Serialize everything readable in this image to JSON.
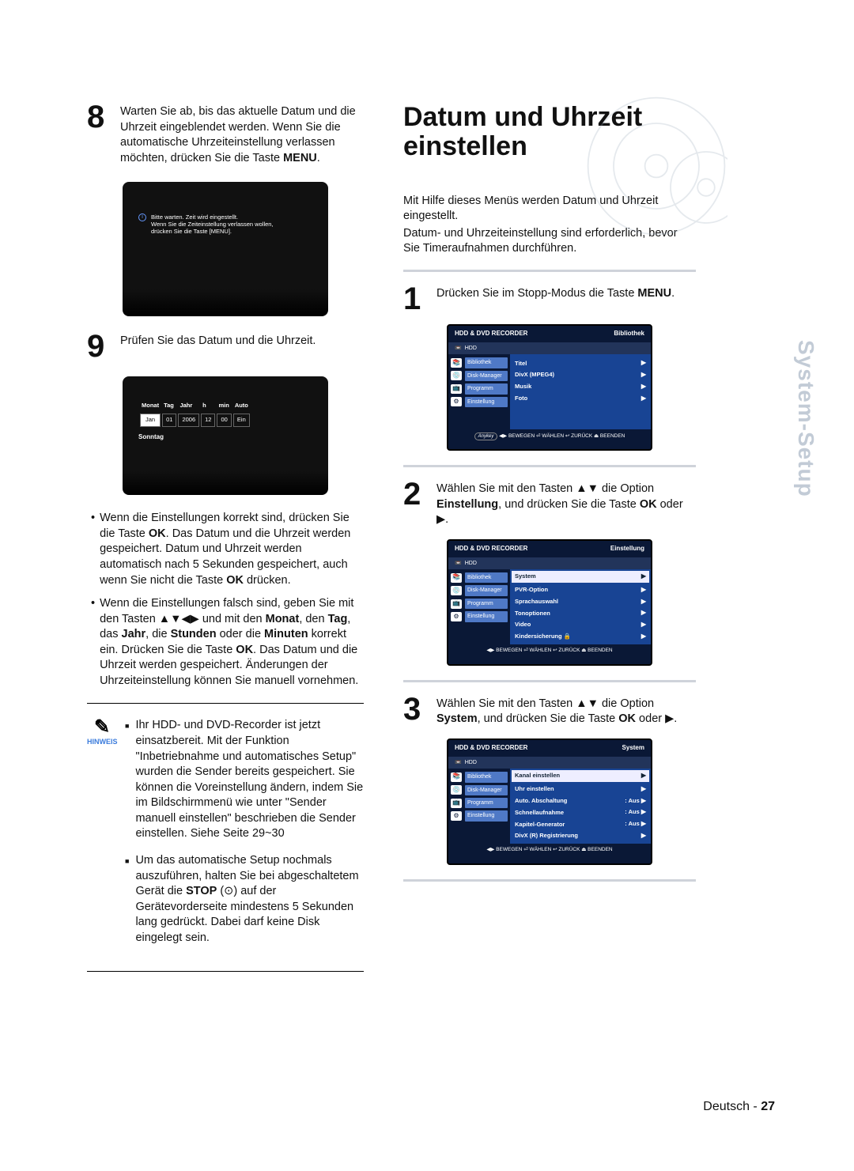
{
  "left": {
    "step8": {
      "num": "8",
      "text_a": "Warten Sie ab, bis das aktuelle Datum und die Uhrzeit eingeblendet werden. Wenn Sie die automatische Uhrzeiteinstellung verlassen möchten, drücken Sie die Taste ",
      "text_b": "MENU",
      "text_c": "."
    },
    "osd1": {
      "l1": "Bitte warten. Zeit wird eingestellt.",
      "l2": "Wenn Sie die Zeiteinstellung verlassen wollen,",
      "l3": "drücken Sie die Taste [MENU]."
    },
    "step9": {
      "num": "9",
      "text": "Prüfen Sie das Datum und die Uhrzeit."
    },
    "date": {
      "hdr": [
        "Monat",
        "Tag",
        "Jahr",
        "h",
        "min",
        "Auto"
      ],
      "row": [
        "Jan",
        "01",
        "2006",
        "12",
        "00",
        "Ein"
      ],
      "day": "Sonntag"
    },
    "bul1": {
      "a1": "Wenn die Einstellungen korrekt sind, drücken Sie die Taste ",
      "a2": "OK",
      "a3": ". Das Datum und die Uhrzeit werden gespeichert. Datum und Uhrzeit werden automatisch nach 5 Sekunden gespeichert, auch wenn Sie nicht die Taste ",
      "a4": "OK",
      "a5": " drücken."
    },
    "bul2": {
      "a1": "Wenn die Einstellungen falsch sind, geben Sie mit den Tasten ▲▼◀▶ und mit den ",
      "a2": "Monat",
      "a3": ", den ",
      "a4": "Tag",
      "a5": ", das ",
      "a6": "Jahr",
      "a7": ", die ",
      "a8": "Stunden",
      "a9": " oder die ",
      "a10": "Minuten",
      "a11": " korrekt ein. Drücken Sie die Taste ",
      "a12": "OK",
      "a13": ". Das Datum und die Uhrzeit werden gespeichert. Änderungen der Uhrzeiteinstellung können Sie manuell vornehmen."
    },
    "hinweis_label": "HINWEIS",
    "note1": "Ihr HDD- und DVD-Recorder ist jetzt einsatzbereit. Mit der Funktion \"Inbetriebnahme und automatisches Setup\" wurden die Sender bereits gespeichert. Sie können die Voreinstellung ändern, indem Sie im Bildschirmmenü wie unter \"Sender manuell einstellen\" beschrieben die Sender einstellen. Siehe Seite 29~30",
    "note2_a": "Um das automatische Setup nochmals auszuführen, halten Sie bei abgeschaltetem Gerät die ",
    "note2_b": "STOP",
    "note2_c": " (⊙) auf der Gerätevorderseite mindestens 5 Sekunden lang gedrückt. Dabei darf keine Disk eingelegt sein."
  },
  "right": {
    "title": "Datum und Uhrzeit einstellen",
    "intro1": "Mit Hilfe dieses Menüs werden Datum und Uhrzeit eingestellt.",
    "intro2": "Datum- und Uhrzeiteinstellung sind erforderlich, bevor Sie Timeraufnahmen durchführen.",
    "s1": {
      "num": "1",
      "a": "Drücken Sie im Stopp-Modus die Taste ",
      "b": "MENU",
      "c": "."
    },
    "menu1": {
      "top_l": "HDD & DVD RECORDER",
      "top_r": "Bibliothek",
      "sub": "HDD",
      "side": [
        "Bibliothek",
        "Disk-Manager",
        "Programm",
        "Einstellung"
      ],
      "items": [
        "Titel",
        "DivX (MPEG4)",
        "Musik",
        "Foto"
      ],
      "foot_any": "Anykey",
      "foot": "◀▶ BEWEGEN   ⏎ WÄHLEN   ↩ ZURÜCK   ⏏ BEENDEN"
    },
    "s2": {
      "num": "2",
      "a": "Wählen Sie mit den Tasten ▲▼ die Option ",
      "b": "Einstellung",
      "c": ", und drücken Sie die Taste ",
      "d": "OK",
      "e": " oder ▶."
    },
    "menu2": {
      "top_l": "HDD & DVD RECORDER",
      "top_r": "Einstellung",
      "sub": "HDD",
      "side": [
        "Bibliothek",
        "Disk-Manager",
        "Programm",
        "Einstellung"
      ],
      "hi": "System",
      "items": [
        "PVR-Option",
        "Sprachauswahl",
        "Tonoptionen",
        "Video",
        "Kindersicherung 🔒"
      ],
      "foot": "◀▶ BEWEGEN   ⏎ WÄHLEN   ↩ ZURÜCK   ⏏ BEENDEN"
    },
    "s3": {
      "num": "3",
      "a": "Wählen Sie mit den Tasten ▲▼ die Option ",
      "b": "System",
      "c": ", und drücken Sie die Taste ",
      "d": "OK",
      "e": " oder ▶."
    },
    "menu3": {
      "top_l": "HDD & DVD RECORDER",
      "top_r": "System",
      "sub": "HDD",
      "side": [
        "Bibliothek",
        "Disk-Manager",
        "Programm",
        "Einstellung"
      ],
      "hi": "Kanal einstellen",
      "items": [
        {
          "l": "Uhr einstellen",
          "r": ""
        },
        {
          "l": "Auto. Abschaltung",
          "r": ": Aus"
        },
        {
          "l": "Schnellaufnahme",
          "r": ": Aus"
        },
        {
          "l": "Kapitel-Generator",
          "r": ": Aus"
        },
        {
          "l": "DivX (R) Registrierung",
          "r": ""
        }
      ],
      "foot": "◀▶ BEWEGEN   ⏎ WÄHLEN   ↩ ZURÜCK   ⏏ BEENDEN"
    }
  },
  "sidetab": "System-Setup",
  "footer_lang": "Deutsch",
  "footer_dash": " - ",
  "footer_page": "27"
}
